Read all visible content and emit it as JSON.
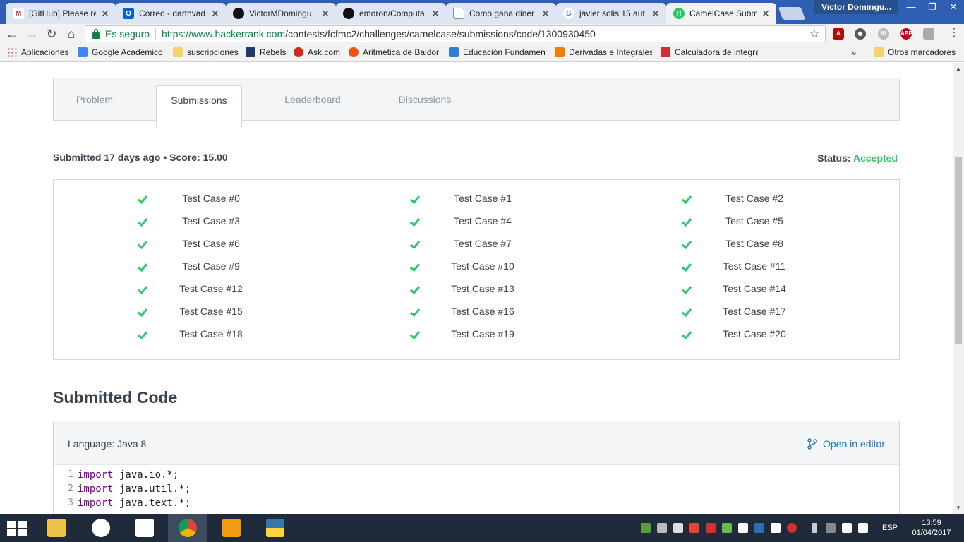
{
  "browser": {
    "tabs": [
      {
        "title": "[GitHub] Please re",
        "icon": "gmail-icon",
        "color": "#d93025"
      },
      {
        "title": "Correo - darthvad",
        "icon": "outlook-icon",
        "color": "#0a64c8"
      },
      {
        "title": "VictorMDomingu",
        "icon": "github-icon",
        "color": "#111111"
      },
      {
        "title": "emoron/Computa",
        "icon": "github-icon",
        "color": "#111111"
      },
      {
        "title": "Como gana diner",
        "icon": "document-icon",
        "color": "#888888"
      },
      {
        "title": "javier solis 15 aut",
        "icon": "google-icon",
        "color": "#4285f4"
      },
      {
        "title": "CamelCase Subm",
        "icon": "hackerrank-icon",
        "color": "#2ec866"
      }
    ],
    "profile_name": "Victor Domingu...",
    "secure_label": "Es seguro",
    "url_host": "https://www.hackerrank.com",
    "url_path": "/contests/fcfmc2/challenges/camelcase/submissions/code/1300930450",
    "bookmarks": [
      {
        "label": "Aplicaciones",
        "color": "#e94235"
      },
      {
        "label": "Google Académico",
        "color": "#4285f4"
      },
      {
        "label": "suscripciones",
        "color": "#f6d26b"
      },
      {
        "label": "Rebels",
        "color": "#1d3b6a"
      },
      {
        "label": "Ask.com",
        "color": "#d52b1e"
      },
      {
        "label": "Aritmética de Baldor",
        "color": "#f2500f"
      },
      {
        "label": "Educación Fundament",
        "color": "#2f80d1"
      },
      {
        "label": "Derivadas e Integrales",
        "color": "#f57c00"
      },
      {
        "label": "Calculadora de integra",
        "color": "#d32f2f"
      }
    ],
    "bookmarks_overflow": "»",
    "other_bookmarks": "Otros marcadores"
  },
  "page": {
    "tabs": [
      "Problem",
      "Submissions",
      "Leaderboard",
      "Discussions"
    ],
    "active_tab": 1,
    "submitted": "Submitted 17 days ago",
    "separator": "•",
    "score": "Score: 15.00",
    "status_label": "Status:",
    "status_value": "Accepted",
    "test_cases": [
      "Test Case #0",
      "Test Case #1",
      "Test Case #2",
      "Test Case #3",
      "Test Case #4",
      "Test Case #5",
      "Test Case #6",
      "Test Case #7",
      "Test Case #8",
      "Test Case #9",
      "Test Case #10",
      "Test Case #11",
      "Test Case #12",
      "Test Case #13",
      "Test Case #14",
      "Test Case #15",
      "Test Case #16",
      "Test Case #17",
      "Test Case #18",
      "Test Case #19",
      "Test Case #20"
    ],
    "code_title": "Submitted Code",
    "language": "Language: Java 8",
    "open_editor": "Open in editor",
    "code_lines": [
      {
        "n": "1",
        "kw": "import",
        "rest": " java.io.*;"
      },
      {
        "n": "2",
        "kw": "import",
        "rest": " java.util.*;"
      },
      {
        "n": "3",
        "kw": "import",
        "rest": " java.text.*;"
      }
    ]
  },
  "taskbar": {
    "language": "ESP",
    "time": "13:59",
    "date": "01/04/2017"
  },
  "colors": {
    "accent_green": "#2ec866",
    "link_blue": "#1a78c2",
    "text_dark": "#39424e"
  }
}
